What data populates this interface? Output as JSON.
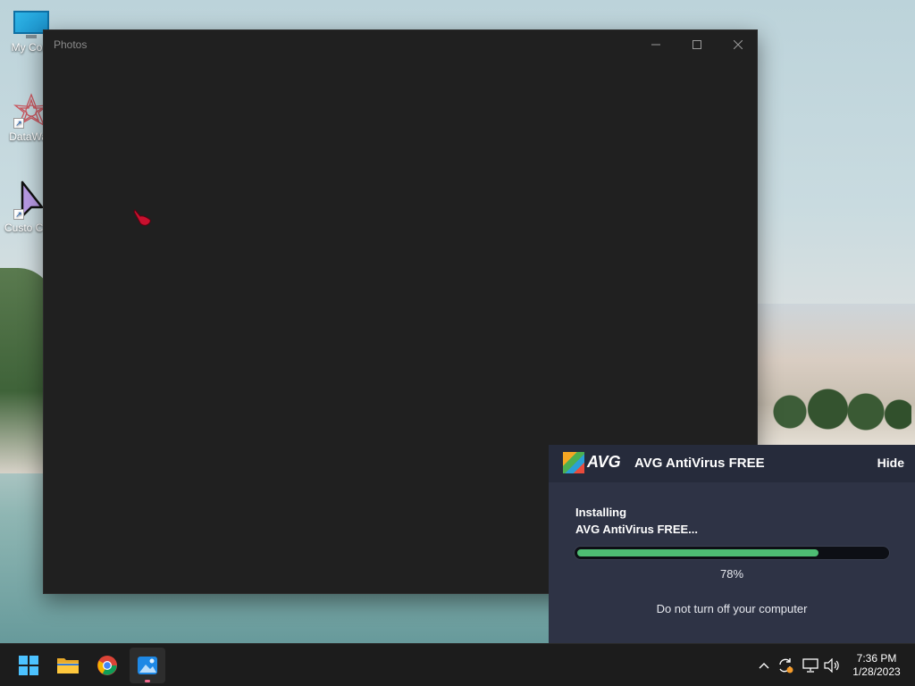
{
  "desktop": {
    "icons": [
      {
        "label": "My Com",
        "icon": "computer-icon"
      },
      {
        "label": "DataWag",
        "icon": "datawag-icon"
      },
      {
        "label": "Custo Curs",
        "icon": "cursor-icon"
      }
    ]
  },
  "photos_window": {
    "title": "Photos",
    "controls": {
      "minimize": "minimize-icon",
      "maximize": "maximize-icon",
      "close": "close-icon"
    }
  },
  "avg_popup": {
    "logo_text": "AVG",
    "title": "AVG AntiVirus FREE",
    "hide_label": "Hide",
    "status_line1": "Installing",
    "status_line2": "AVG AntiVirus FREE...",
    "progress": 0.78,
    "progress_label": "78%",
    "note": "Do not turn off your computer",
    "colors": {
      "background": "#2e3345",
      "header": "#262b3b",
      "progress": "#4ebd73"
    }
  },
  "taskbar": {
    "apps": [
      {
        "name": "Start",
        "icon": "windows-start-icon"
      },
      {
        "name": "File Explorer",
        "icon": "folder-icon"
      },
      {
        "name": "Google Chrome",
        "icon": "chrome-icon"
      },
      {
        "name": "Photos",
        "icon": "photos-icon",
        "active": true
      }
    ],
    "tray": [
      "chevron-up-icon",
      "update-icon",
      "network-icon",
      "volume-icon"
    ],
    "clock": {
      "time": "7:36 PM",
      "date": "1/28/2023"
    }
  }
}
